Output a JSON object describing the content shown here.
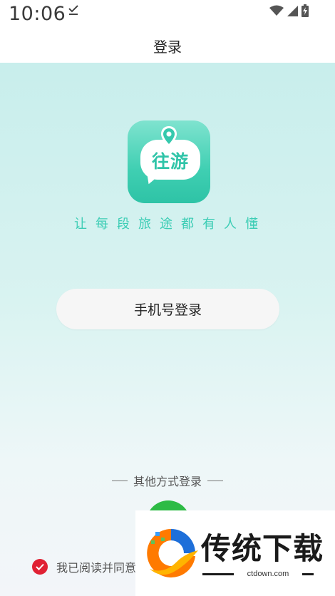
{
  "status_bar": {
    "time": "10:06"
  },
  "header": {
    "title": "登录"
  },
  "brand": {
    "logo_text": "往游",
    "slogan": "让每段旅途都有人懂"
  },
  "login": {
    "phone_button_label": "手机号登录",
    "other_methods_label": "其他方式登录"
  },
  "agreement": {
    "text": "我已阅读并同意"
  },
  "watermark": {
    "title": "传统下载",
    "url": "ctdown.com"
  },
  "colors": {
    "accent": "#3ccdb5",
    "wechat": "#2dbb45",
    "checkbox": "#e02134"
  }
}
